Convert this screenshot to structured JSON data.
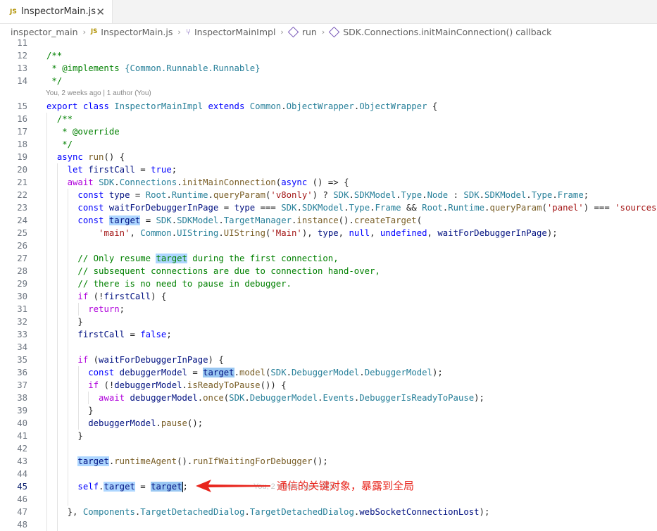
{
  "tab": {
    "badge": "JS",
    "title": "InspectorMain.js",
    "close": "✕"
  },
  "breadcrumb": {
    "items": [
      "inspector_main",
      "InspectorMain.js",
      "InspectorMainImpl",
      "run",
      "SDK.Connections.initMainConnection() callback"
    ],
    "js_badge": "JS"
  },
  "blame": "You, 2 weeks ago | 1 author (You)",
  "ghost_blame": "You, 2 weeks ago • 通过",
  "annotation": {
    "text": "通信的关键对象，暴露到全局",
    "color": "#e8261e"
  },
  "code_lines": [
    {
      "n": "11",
      "t": ""
    },
    {
      "n": "12",
      "t": "/**"
    },
    {
      "n": "13",
      "t": " * @implements {Common.Runnable.Runnable}"
    },
    {
      "n": "14",
      "t": " */"
    },
    {
      "n": "15",
      "t": "export class InspectorMainImpl extends Common.ObjectWrapper.ObjectWrapper {"
    },
    {
      "n": "16",
      "t": "  /**"
    },
    {
      "n": "17",
      "t": "   * @override"
    },
    {
      "n": "18",
      "t": "   */"
    },
    {
      "n": "19",
      "t": "  async run() {"
    },
    {
      "n": "20",
      "t": "    let firstCall = true;"
    },
    {
      "n": "21",
      "t": "    await SDK.Connections.initMainConnection(async () => {"
    },
    {
      "n": "22",
      "t": "      const type = Root.Runtime.queryParam('v8only') ? SDK.SDKModel.Type.Node : SDK.SDKModel.Type.Frame;"
    },
    {
      "n": "23",
      "t": "      const waitForDebuggerInPage = type === SDK.SDKModel.Type.Frame && Root.Runtime.queryParam('panel') === 'sources';"
    },
    {
      "n": "24",
      "t": "      const target = SDK.SDKModel.TargetManager.instance().createTarget("
    },
    {
      "n": "25",
      "t": "          'main', Common.UIString.UIString('Main'), type, null, undefined, waitForDebuggerInPage);"
    },
    {
      "n": "26",
      "t": ""
    },
    {
      "n": "27",
      "t": "      // Only resume target during the first connection,"
    },
    {
      "n": "28",
      "t": "      // subsequent connections are due to connection hand-over,"
    },
    {
      "n": "29",
      "t": "      // there is no need to pause in debugger."
    },
    {
      "n": "30",
      "t": "      if (!firstCall) {"
    },
    {
      "n": "31",
      "t": "        return;"
    },
    {
      "n": "32",
      "t": "      }"
    },
    {
      "n": "33",
      "t": "      firstCall = false;"
    },
    {
      "n": "34",
      "t": ""
    },
    {
      "n": "35",
      "t": "      if (waitForDebuggerInPage) {"
    },
    {
      "n": "36",
      "t": "        const debuggerModel = target.model(SDK.DebuggerModel.DebuggerModel);"
    },
    {
      "n": "37",
      "t": "        if (!debuggerModel.isReadyToPause()) {"
    },
    {
      "n": "38",
      "t": "          await debuggerModel.once(SDK.DebuggerModel.Events.DebuggerIsReadyToPause);"
    },
    {
      "n": "39",
      "t": "        }"
    },
    {
      "n": "40",
      "t": "        debuggerModel.pause();"
    },
    {
      "n": "41",
      "t": "      }"
    },
    {
      "n": "42",
      "t": ""
    },
    {
      "n": "43",
      "t": "      target.runtimeAgent().runIfWaitingForDebugger();"
    },
    {
      "n": "44",
      "t": ""
    },
    {
      "n": "45",
      "t": "      self.target = target;"
    },
    {
      "n": "46",
      "t": ""
    },
    {
      "n": "47",
      "t": "    }, Components.TargetDetachedDialog.TargetDetachedDialog.webSocketConnectionLost);"
    },
    {
      "n": "48",
      "t": ""
    }
  ],
  "colors": {
    "keyword": "#0000ff",
    "control": "#af00db",
    "comment": "#008000",
    "type": "#267f99",
    "function": "#795e26",
    "variable": "#001080",
    "string": "#a31515",
    "highlight": "#add6ff"
  }
}
